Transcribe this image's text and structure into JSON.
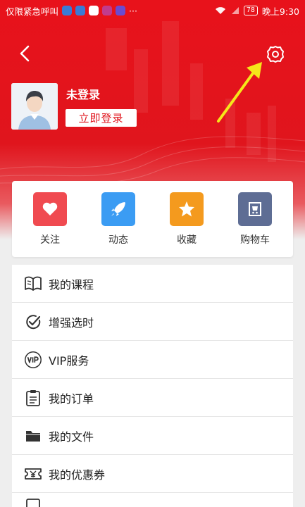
{
  "status_bar": {
    "carrier": "仅限紧急呼叫",
    "battery": "78",
    "time": "晚上9:30"
  },
  "header": {
    "back_icon": "chevron-left-icon",
    "settings_icon": "gear-icon"
  },
  "profile": {
    "username": "未登录",
    "login_label": "立即登录"
  },
  "quick_actions": [
    {
      "label": "关注",
      "icon": "heart-icon",
      "color": "#f04a50"
    },
    {
      "label": "动态",
      "icon": "rocket-icon",
      "color": "#3b9cf3"
    },
    {
      "label": "收藏",
      "icon": "star-icon",
      "color": "#f49a1e"
    },
    {
      "label": "购物车",
      "icon": "cart-icon",
      "color": "#5e6d94"
    }
  ],
  "menu": [
    {
      "label": "我的课程",
      "icon": "book-icon"
    },
    {
      "label": "增强选时",
      "icon": "check-circle-icon"
    },
    {
      "label": "VIP服务",
      "icon": "vip-icon"
    },
    {
      "label": "我的订单",
      "icon": "clipboard-icon"
    },
    {
      "label": "我的文件",
      "icon": "folder-icon"
    },
    {
      "label": "我的优惠券",
      "icon": "coupon-icon"
    }
  ],
  "colors": {
    "brand_red": "#e0151d",
    "annotation_arrow": "#f5e61a"
  }
}
